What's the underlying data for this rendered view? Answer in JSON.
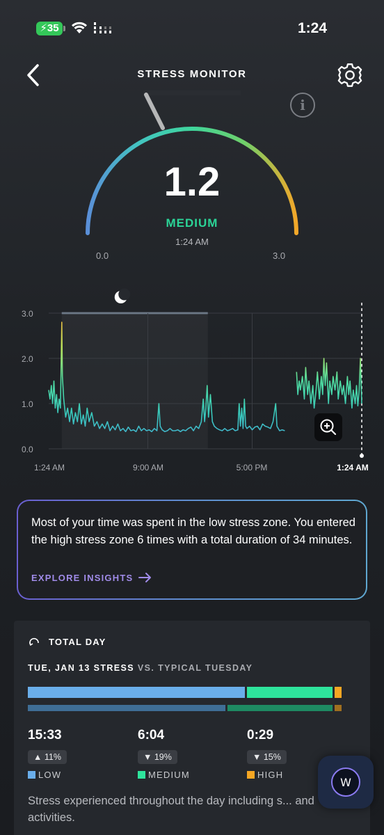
{
  "status_bar": {
    "battery": "35",
    "time": "1:24"
  },
  "header": {
    "title": "STRESS MONITOR"
  },
  "gauge": {
    "value": "1.2",
    "numeric_value": 1.2,
    "min": "0.0",
    "max": "3.0",
    "min_value": 0,
    "max_value": 3,
    "level": "MEDIUM",
    "time": "1:24 AM",
    "info_label": "i"
  },
  "chart_data": {
    "type": "line",
    "title": "",
    "xlabel": "",
    "ylabel": "",
    "ylim": [
      0,
      3
    ],
    "y_ticks": [
      "0.0",
      "1.0",
      "2.0",
      "3.0"
    ],
    "x_ticks": [
      "1:24 AM",
      "9:00 AM",
      "5:00 PM",
      "1:24 AM"
    ],
    "x_range_hours": [
      0,
      24
    ],
    "sleep_band_hours": [
      1.0,
      12.2
    ],
    "sleep_icon": "moon-icon",
    "series": [
      {
        "color": "#3ec9b8",
        "segments": [
          [
            [
              0.0,
              1.3
            ],
            [
              0.1,
              1.1
            ],
            [
              0.2,
              1.4
            ],
            [
              0.3,
              1.0
            ],
            [
              0.4,
              1.5
            ],
            [
              0.5,
              0.9
            ],
            [
              0.6,
              1.2
            ],
            [
              0.7,
              0.8
            ],
            [
              0.8,
              1.1
            ],
            [
              0.9,
              0.9
            ],
            [
              1.0,
              2.8
            ],
            [
              1.05,
              1.6
            ],
            [
              1.15,
              1.1
            ],
            [
              1.3,
              0.7
            ],
            [
              1.45,
              0.9
            ],
            [
              1.6,
              0.6
            ],
            [
              1.75,
              0.9
            ],
            [
              1.9,
              0.55
            ],
            [
              2.05,
              0.8
            ],
            [
              2.2,
              0.6
            ],
            [
              2.35,
              1.0
            ],
            [
              2.5,
              0.55
            ],
            [
              2.65,
              0.75
            ],
            [
              2.8,
              0.5
            ],
            [
              2.95,
              0.9
            ],
            [
              3.1,
              0.6
            ],
            [
              3.3,
              0.8
            ],
            [
              3.5,
              0.5
            ],
            [
              3.7,
              0.6
            ],
            [
              3.9,
              0.45
            ],
            [
              4.1,
              0.55
            ],
            [
              4.3,
              0.45
            ],
            [
              4.5,
              0.6
            ],
            [
              4.7,
              0.4
            ],
            [
              4.9,
              0.5
            ],
            [
              5.1,
              0.42
            ],
            [
              5.3,
              0.55
            ],
            [
              5.5,
              0.4
            ],
            [
              5.7,
              0.45
            ],
            [
              5.9,
              0.38
            ],
            [
              6.1,
              0.48
            ],
            [
              6.3,
              0.4
            ],
            [
              6.5,
              0.42
            ],
            [
              6.7,
              0.38
            ],
            [
              6.9,
              0.5
            ],
            [
              7.1,
              0.4
            ],
            [
              7.3,
              0.45
            ],
            [
              7.5,
              0.4
            ],
            [
              7.7,
              0.42
            ],
            [
              7.9,
              0.38
            ],
            [
              8.1,
              0.45
            ],
            [
              8.3,
              0.4
            ],
            [
              8.45,
              1.0
            ],
            [
              8.55,
              0.5
            ],
            [
              8.7,
              0.42
            ],
            [
              8.9,
              0.38
            ],
            [
              9.1,
              0.4
            ],
            [
              9.3,
              0.45
            ],
            [
              9.5,
              0.4
            ],
            [
              9.7,
              0.4
            ],
            [
              9.9,
              0.42
            ],
            [
              10.1,
              0.38
            ],
            [
              10.3,
              0.42
            ],
            [
              10.5,
              0.4
            ],
            [
              10.7,
              0.45
            ],
            [
              10.9,
              0.48
            ],
            [
              11.1,
              0.4
            ],
            [
              11.3,
              0.5
            ],
            [
              11.5,
              0.45
            ],
            [
              11.7,
              0.6
            ],
            [
              11.85,
              1.1
            ],
            [
              11.95,
              0.6
            ],
            [
              12.05,
              0.9
            ],
            [
              12.15,
              1.4
            ],
            [
              12.25,
              0.7
            ],
            [
              12.4,
              1.2
            ],
            [
              12.55,
              0.6
            ],
            [
              12.7,
              0.5
            ],
            [
              12.9,
              0.45
            ],
            [
              13.1,
              0.42
            ],
            [
              13.3,
              0.4
            ],
            [
              13.5,
              0.45
            ],
            [
              13.7,
              0.4
            ],
            [
              13.9,
              0.42
            ],
            [
              14.1,
              0.45
            ],
            [
              14.3,
              0.4
            ],
            [
              14.5,
              0.42
            ],
            [
              14.6,
              1.0
            ],
            [
              14.7,
              0.5
            ],
            [
              14.8,
              0.9
            ],
            [
              14.9,
              0.45
            ],
            [
              15.0,
              1.1
            ],
            [
              15.1,
              0.5
            ],
            [
              15.2,
              0.45
            ],
            [
              15.4,
              0.5
            ],
            [
              15.6,
              0.42
            ],
            [
              15.8,
              0.48
            ],
            [
              16.0,
              0.5
            ],
            [
              16.2,
              0.42
            ],
            [
              16.4,
              0.55
            ],
            [
              16.6,
              0.5
            ],
            [
              16.8,
              0.48
            ],
            [
              17.0,
              0.45
            ],
            [
              17.2,
              0.6
            ],
            [
              17.4,
              1.0
            ],
            [
              17.5,
              0.5
            ],
            [
              17.7,
              0.4
            ],
            [
              17.9,
              0.42
            ],
            [
              18.1,
              0.4
            ]
          ],
          [
            [
              19.0,
              1.7
            ],
            [
              19.1,
              1.2
            ],
            [
              19.2,
              1.5
            ],
            [
              19.3,
              1.3
            ],
            [
              19.45,
              1.6
            ],
            [
              19.6,
              1.1
            ],
            [
              19.7,
              1.8
            ],
            [
              19.85,
              1.2
            ],
            [
              19.95,
              1.5
            ],
            [
              20.1,
              1.0
            ],
            [
              20.25,
              1.4
            ],
            [
              20.35,
              0.9
            ],
            [
              20.5,
              1.3
            ],
            [
              20.6,
              1.7
            ],
            [
              20.75,
              1.1
            ],
            [
              20.9,
              1.6
            ],
            [
              21.0,
              1.2
            ],
            [
              21.1,
              2.0
            ],
            [
              21.2,
              1.4
            ],
            [
              21.3,
              1.9
            ],
            [
              21.45,
              1.0
            ],
            [
              21.55,
              1.5
            ],
            [
              21.7,
              1.2
            ],
            [
              21.8,
              1.6
            ],
            [
              21.95,
              1.3
            ],
            [
              22.1,
              1.7
            ],
            [
              22.2,
              1.1
            ],
            [
              22.35,
              1.5
            ],
            [
              22.5,
              1.2
            ],
            [
              22.6,
              1.4
            ],
            [
              22.75,
              1.0
            ],
            [
              22.9,
              1.6
            ],
            [
              23.0,
              1.2
            ],
            [
              23.1,
              1.5
            ],
            [
              23.25,
              0.9
            ],
            [
              23.35,
              1.3
            ],
            [
              23.5,
              1.0
            ],
            [
              23.6,
              1.4
            ],
            [
              23.7,
              0.95
            ],
            [
              23.8,
              1.3
            ],
            [
              23.9,
              2.0
            ],
            [
              24.0,
              1.0
            ]
          ]
        ]
      }
    ]
  },
  "zoom_icon": "zoom-in-icon",
  "insight": {
    "text": "Most of your time was spent in the low stress zone. You entered the high stress zone 6 times with a total duration of 34 minutes.",
    "link": "EXPLORE INSIGHTS"
  },
  "total_day": {
    "title": "TOTAL DAY",
    "compare_date": "TUE, JAN 13 STRESS",
    "compare_vs": "VS. TYPICAL TUESDAY",
    "today_fractions": [
      0.66,
      0.26,
      0.02
    ],
    "typical_fractions": [
      0.6,
      0.32,
      0.02
    ],
    "colors": {
      "low": "#6aaeea",
      "medium": "#2ee49c",
      "high": "#f5a623",
      "low_typical": "#3f6e96",
      "medium_typical": "#1e8a62",
      "high_typical": "#a06f1f"
    },
    "stats": [
      {
        "value": "15:33",
        "delta_arrow": "▲",
        "delta": "11%",
        "label": "LOW",
        "color": "#6aaeea"
      },
      {
        "value": "6:04",
        "delta_arrow": "▼",
        "delta": "19%",
        "label": "MEDIUM",
        "color": "#2ee49c"
      },
      {
        "value": "0:29",
        "delta_arrow": "▼",
        "delta": "15%",
        "label": "HIGH",
        "color": "#f5a623"
      }
    ],
    "description": "Stress experienced throughout the day including s... and activities."
  },
  "fab": {
    "label": "W"
  }
}
